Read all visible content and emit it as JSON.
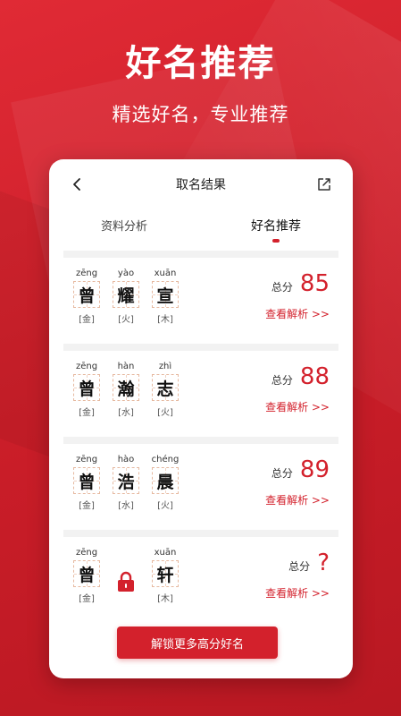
{
  "promo": {
    "headline": "好名推荐",
    "subhead": "精选好名，专业推荐"
  },
  "navbar": {
    "title": "取名结果",
    "back_icon": "chevron-left-icon",
    "share_icon": "share-icon"
  },
  "tabs": [
    {
      "label": "资料分析",
      "active": false
    },
    {
      "label": "好名推荐",
      "active": true
    }
  ],
  "names": [
    {
      "chars": [
        {
          "pinyin": "zēng",
          "hanzi": "曾",
          "element": "[金]"
        },
        {
          "pinyin": "yào",
          "hanzi": "耀",
          "element": "[火]"
        },
        {
          "pinyin": "xuān",
          "hanzi": "宣",
          "element": "[木]"
        }
      ],
      "score_label": "总分",
      "score": "85",
      "detail_link": "查看解析 >>"
    },
    {
      "chars": [
        {
          "pinyin": "zēng",
          "hanzi": "曾",
          "element": "[金]"
        },
        {
          "pinyin": "hàn",
          "hanzi": "瀚",
          "element": "[水]"
        },
        {
          "pinyin": "zhì",
          "hanzi": "志",
          "element": "[火]"
        }
      ],
      "score_label": "总分",
      "score": "88",
      "detail_link": "查看解析 >>"
    },
    {
      "chars": [
        {
          "pinyin": "zēng",
          "hanzi": "曾",
          "element": "[金]"
        },
        {
          "pinyin": "hào",
          "hanzi": "浩",
          "element": "[水]"
        },
        {
          "pinyin": "chéng",
          "hanzi": "晨",
          "element": "[火]"
        }
      ],
      "score_label": "总分",
      "score": "89",
      "detail_link": "查看解析 >>"
    },
    {
      "chars": [
        {
          "pinyin": "zēng",
          "hanzi": "曾",
          "element": "[金]"
        },
        {
          "locked": true
        },
        {
          "pinyin": "xuān",
          "hanzi": "轩",
          "element": "[木]"
        }
      ],
      "score_label": "总分",
      "score": "?",
      "detail_link": "查看解析 >>"
    }
  ],
  "unlock_button": "解锁更多高分好名",
  "colors": {
    "brand_red": "#d3212c",
    "grid_dash": "#e6b9a0"
  }
}
